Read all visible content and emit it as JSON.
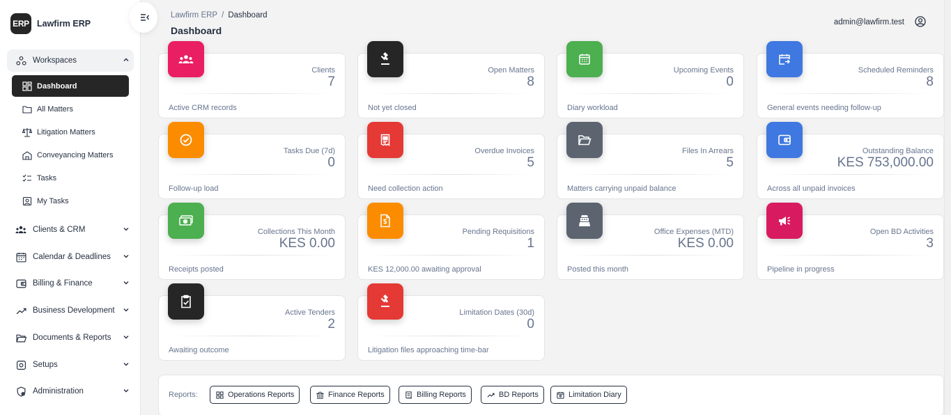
{
  "brand": {
    "logo": "ERP",
    "name": "Lawfirm ERP"
  },
  "sidebar": {
    "workspaces": {
      "label": "Workspaces",
      "icon": "workspaces-icon"
    },
    "sub_items": [
      {
        "label": "Dashboard",
        "icon": "dashboard-icon",
        "active": true
      },
      {
        "label": "All Matters",
        "icon": "folder-icon"
      },
      {
        "label": "Litigation Matters",
        "icon": "scales-icon"
      },
      {
        "label": "Conveyancing Matters",
        "icon": "building-icon"
      },
      {
        "label": "Tasks",
        "icon": "checklist-icon"
      },
      {
        "label": "My Tasks",
        "icon": "user-task-icon"
      }
    ],
    "groups": [
      {
        "label": "Clients & CRM",
        "icon": "clients-icon"
      },
      {
        "label": "Calendar & Deadlines",
        "icon": "calendar-icon"
      },
      {
        "label": "Billing & Finance",
        "icon": "wallet-icon"
      },
      {
        "label": "Business Development",
        "icon": "trend-icon"
      },
      {
        "label": "Documents & Reports",
        "icon": "folder-open-icon"
      },
      {
        "label": "Setups",
        "icon": "settings-icon"
      },
      {
        "label": "Administration",
        "icon": "shield-icon"
      }
    ]
  },
  "header": {
    "breadcrumb_root": "Lawfirm ERP",
    "breadcrumb_sep": "/",
    "breadcrumb_current": "Dashboard",
    "title": "Dashboard",
    "user_email": "admin@lawfirm.test"
  },
  "cards": [
    {
      "label": "Clients",
      "value": "7",
      "foot": "Active CRM records",
      "color": "#e91e63",
      "icon": "users-icon"
    },
    {
      "label": "Open Matters",
      "value": "8",
      "foot": "Not yet closed",
      "color": "#262626",
      "icon": "gavel-icon"
    },
    {
      "label": "Upcoming Events",
      "value": "0",
      "foot": "Diary workload",
      "color": "#4caf50",
      "icon": "calendar-icon"
    },
    {
      "label": "Scheduled Reminders",
      "value": "8",
      "foot": "General events needing follow-up",
      "color": "#3f78e0",
      "icon": "calendar-arrow-icon"
    },
    {
      "label": "Tasks Due (7d)",
      "value": "0",
      "foot": "Follow-up load",
      "color": "#fb8c00",
      "icon": "check-circle-icon"
    },
    {
      "label": "Overdue Invoices",
      "value": "5",
      "foot": "Need collection action",
      "color": "#e53935",
      "icon": "receipt-icon"
    },
    {
      "label": "Files In Arrears",
      "value": "5",
      "foot": "Matters carrying unpaid balance",
      "color": "#5c6470",
      "icon": "folder-open-icon"
    },
    {
      "label": "Outstanding Balance",
      "value": "KES 753,000.00",
      "foot": "Across all unpaid invoices",
      "color": "#3f78e0",
      "icon": "wallet-icon"
    },
    {
      "label": "Collections This Month",
      "value": "KES 0.00",
      "foot": "Receipts posted",
      "color": "#4caf50",
      "icon": "cash-icon"
    },
    {
      "label": "Pending Requisitions",
      "value": "1",
      "foot": "KES 12,000.00 awaiting approval",
      "color": "#fb8c00",
      "icon": "document-dollar-icon"
    },
    {
      "label": "Office Expenses (MTD)",
      "value": "KES 0.00",
      "foot": "Posted this month",
      "color": "#5c6470",
      "icon": "register-icon"
    },
    {
      "label": "Open BD Activities",
      "value": "3",
      "foot": "Pipeline in progress",
      "color": "#d81b60",
      "icon": "megaphone-icon"
    },
    {
      "label": "Active Tenders",
      "value": "2",
      "foot": "Awaiting outcome",
      "color": "#262626",
      "icon": "clipboard-check-icon"
    },
    {
      "label": "Limitation Dates (30d)",
      "value": "0",
      "foot": "Litigation files approaching time-bar",
      "color": "#e53935",
      "icon": "gavel-icon"
    }
  ],
  "reports": {
    "label": "Reports:",
    "buttons": [
      {
        "label": "Operations Reports",
        "icon": "grid-icon"
      },
      {
        "label": "Finance Reports",
        "icon": "bank-icon"
      },
      {
        "label": "Billing Reports",
        "icon": "receipt-icon"
      },
      {
        "label": "BD Reports",
        "icon": "trend-icon"
      },
      {
        "label": "Limitation Diary",
        "icon": "calendar-icon"
      }
    ]
  }
}
